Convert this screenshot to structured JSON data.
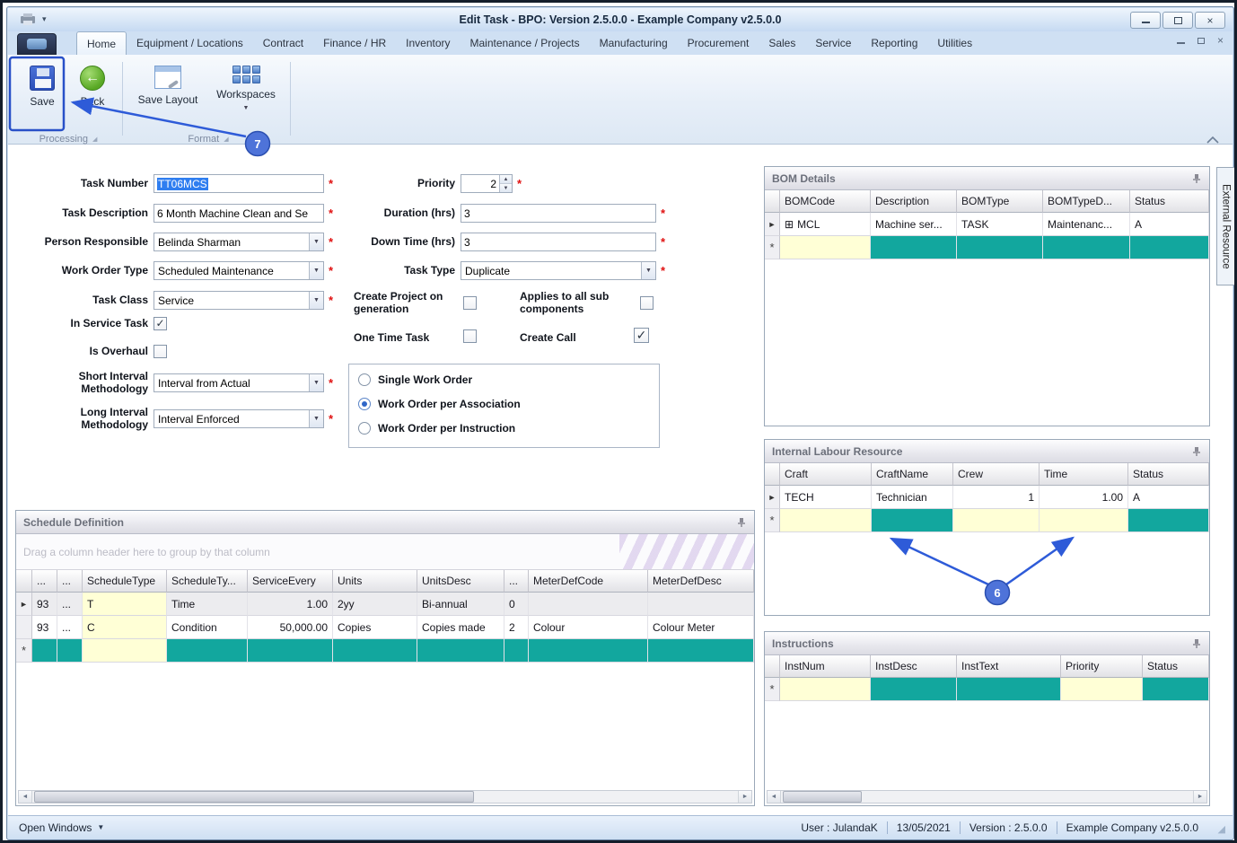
{
  "window": {
    "title": "Edit Task - BPO: Version 2.5.0.0 - Example Company v2.5.0.0"
  },
  "ribbon": {
    "tabs": [
      "Home",
      "Equipment / Locations",
      "Contract",
      "Finance / HR",
      "Inventory",
      "Maintenance / Projects",
      "Manufacturing",
      "Procurement",
      "Sales",
      "Service",
      "Reporting",
      "Utilities"
    ],
    "save": "Save",
    "back": "Back",
    "save_layout": "Save Layout",
    "workspaces": "Workspaces",
    "group_processing": "Processing",
    "group_format": "Format"
  },
  "callouts": {
    "seven": "7",
    "six": "6"
  },
  "form": {
    "required_marker": "*",
    "task_number": {
      "label": "Task Number",
      "value": "TT06MCS"
    },
    "task_description": {
      "label": "Task Description",
      "value": "6 Month Machine Clean and Se"
    },
    "person_responsible": {
      "label": "Person Responsible",
      "value": "Belinda Sharman"
    },
    "work_order_type": {
      "label": "Work Order Type",
      "value": "Scheduled Maintenance"
    },
    "task_class": {
      "label": "Task Class",
      "value": "Service"
    },
    "in_service_task": {
      "label": "In Service Task",
      "check": "✓"
    },
    "is_overhaul": {
      "label": "Is Overhaul",
      "check": ""
    },
    "short_interval": {
      "label": "Short Interval Methodology",
      "value": "Interval from Actual"
    },
    "long_interval": {
      "label": "Long Interval Methodology",
      "value": "Interval Enforced"
    },
    "priority": {
      "label": "Priority",
      "value": "2"
    },
    "duration": {
      "label": "Duration (hrs)",
      "value": "3"
    },
    "down_time": {
      "label": "Down Time (hrs)",
      "value": "3"
    },
    "task_type": {
      "label": "Task Type",
      "value": "Duplicate"
    },
    "create_project": {
      "label": "Create Project on generation",
      "check": ""
    },
    "applies_sub": {
      "label": "Applies to all sub components",
      "check": ""
    },
    "one_time": {
      "label": "One Time Task",
      "check": ""
    },
    "create_call": {
      "label": "Create Call",
      "check": "✓"
    },
    "radio_group": {
      "options": [
        "Single Work Order",
        "Work Order per Association",
        "Work Order per Instruction"
      ],
      "selected": "Work Order per Association"
    }
  },
  "schedule": {
    "title": "Schedule Definition",
    "group_hint": "Drag a column header here to group by that column",
    "headers": [
      "...",
      "...",
      "ScheduleType",
      "ScheduleTy...",
      "ServiceEvery",
      "Units",
      "UnitsDesc",
      "...",
      "MeterDefCode",
      "MeterDefDesc"
    ],
    "rows": [
      [
        "93",
        "...",
        "T",
        "Time",
        "1.00",
        "2yy",
        "Bi-annual",
        "0",
        "",
        ""
      ],
      [
        "93",
        "...",
        "C",
        "Condition",
        "50,000.00",
        "Copies",
        "Copies made",
        "2",
        "Colour",
        "Colour Meter"
      ]
    ]
  },
  "bom": {
    "title": "BOM Details",
    "headers": [
      "BOMCode",
      "Description",
      "BOMType",
      "BOMTypeD...",
      "Status"
    ],
    "rows": [
      [
        "MCL",
        "Machine ser...",
        "TASK",
        "Maintenanc...",
        "A"
      ]
    ]
  },
  "labour": {
    "title": "Internal Labour Resource",
    "headers": [
      "Craft",
      "CraftName",
      "Crew",
      "Time",
      "Status"
    ],
    "rows": [
      [
        "TECH",
        "Technician",
        "1",
        "1.00",
        "A"
      ]
    ]
  },
  "instructions": {
    "title": "Instructions",
    "headers": [
      "InstNum",
      "InstDesc",
      "InstText",
      "Priority",
      "Status"
    ]
  },
  "side_tab": "External Resource",
  "statusbar": {
    "open_windows": "Open Windows",
    "user": "User : JulandaK",
    "date": "13/05/2021",
    "version": "Version : 2.5.0.0",
    "company": "Example Company v2.5.0.0"
  }
}
